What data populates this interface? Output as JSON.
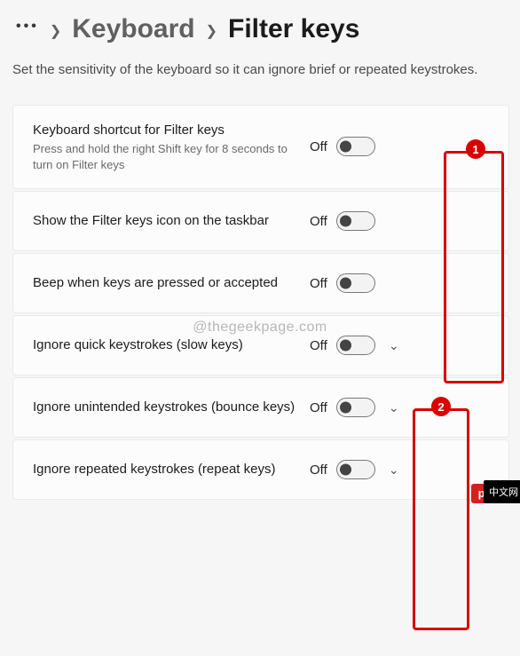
{
  "breadcrumb": {
    "prev": "Keyboard",
    "current": "Filter keys"
  },
  "description": "Set the sensitivity of the keyboard so it can ignore brief or repeated keystrokes.",
  "settings": [
    {
      "title": "Keyboard shortcut for Filter keys",
      "sub": "Press and hold the right Shift key for 8 seconds to turn on Filter keys",
      "status": "Off",
      "expandable": false
    },
    {
      "title": "Show the Filter keys icon on the taskbar",
      "sub": "",
      "status": "Off",
      "expandable": false
    },
    {
      "title": "Beep when keys are pressed or accepted",
      "sub": "",
      "status": "Off",
      "expandable": false
    },
    {
      "title": "Ignore quick keystrokes (slow keys)",
      "sub": "",
      "status": "Off",
      "expandable": true
    },
    {
      "title": "Ignore unintended keystrokes (bounce keys)",
      "sub": "",
      "status": "Off",
      "expandable": true
    },
    {
      "title": "Ignore repeated keystrokes (repeat keys)",
      "sub": "",
      "status": "Off",
      "expandable": true
    }
  ],
  "annotations": {
    "badge1": "1",
    "badge2": "2"
  },
  "watermark": "@thegeekpage.com",
  "footer": {
    "brand": "php",
    "cn": "中文网"
  }
}
